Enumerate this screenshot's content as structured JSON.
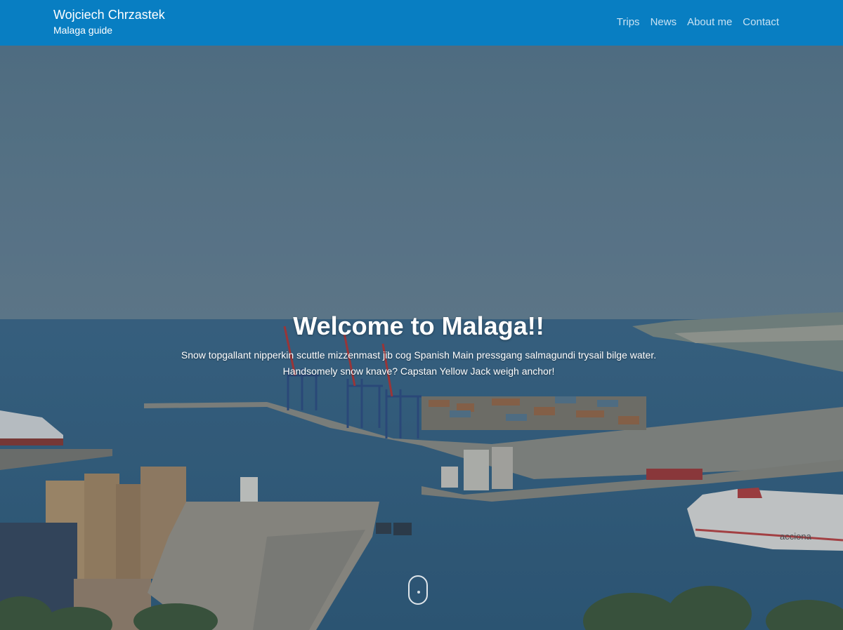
{
  "header": {
    "brand_title": "Wojciech Chrzastek",
    "brand_subtitle": "Malaga guide",
    "nav": [
      {
        "label": "Trips"
      },
      {
        "label": "News"
      },
      {
        "label": "About me"
      },
      {
        "label": "Contact"
      }
    ]
  },
  "hero": {
    "title": "Welcome to Malaga!!",
    "lead_line1": "Snow topgallant nipperkin scuttle mizzenmast jib cog Spanish Main pressgang salmagundi trysail bilge water.",
    "lead_line2": "Handsomely snow knave? Capstan Yellow Jack weigh anchor!",
    "ship_text": "acciona",
    "scroll_icon": "mouse-scroll-icon"
  },
  "colors": {
    "navbar": "#087ec2",
    "nav_link": "#c8e2f3",
    "sky": "#5e7e93",
    "sea": "#3f6d8e"
  }
}
